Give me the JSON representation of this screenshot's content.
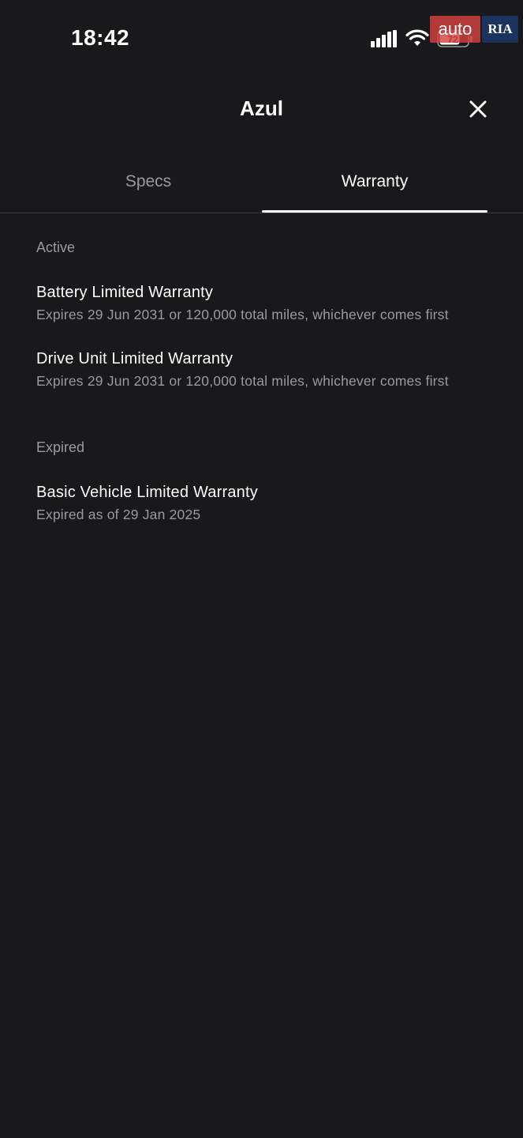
{
  "status_bar": {
    "time": "18:42",
    "battery_level": "72",
    "icons": [
      "signal-icon",
      "wifi-icon",
      "battery-icon"
    ]
  },
  "watermark": {
    "left": "auto",
    "right": "RIA"
  },
  "header": {
    "title": "Azul",
    "close_icon": "close-icon"
  },
  "tabs": [
    {
      "label": "Specs",
      "selected": false
    },
    {
      "label": "Warranty",
      "selected": true
    }
  ],
  "sections": {
    "active": {
      "label": "Active",
      "items": [
        {
          "title": "Battery Limited Warranty",
          "subtitle": "Expires 29 Jun 2031 or 120,000 total miles, whichever comes first"
        },
        {
          "title": "Drive Unit Limited Warranty",
          "subtitle": "Expires 29 Jun 2031 or 120,000 total miles, whichever comes first"
        }
      ]
    },
    "expired": {
      "label": "Expired",
      "items": [
        {
          "title": "Basic Vehicle Limited Warranty",
          "subtitle": "Expired as of 29 Jan 2025"
        }
      ]
    }
  },
  "colors": {
    "background": "#19191b",
    "primary_text": "#ffffff",
    "secondary_text": "#9a9a9e",
    "divider": "#3a3a3d"
  }
}
